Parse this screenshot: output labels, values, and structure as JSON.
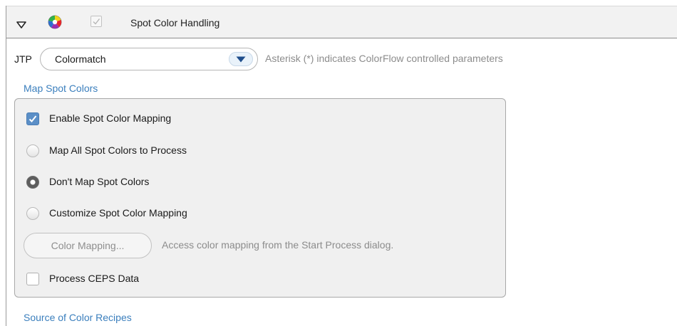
{
  "header": {
    "title": "Spot Color Handling",
    "checked": true,
    "icons": [
      "collapse-triangle-icon",
      "color-wheel-icon",
      "checkmark-icon"
    ]
  },
  "jtp": {
    "label": "JTP",
    "selected": "Colormatch",
    "note": "Asterisk (*) indicates ColorFlow controlled parameters"
  },
  "map_spot_colors": {
    "title": "Map Spot Colors",
    "enable_mapping": {
      "label": "Enable Spot Color Mapping",
      "checked": true
    },
    "options": [
      {
        "label": "Map All Spot Colors to Process",
        "selected": false
      },
      {
        "label": "Don't Map Spot Colors",
        "selected": true
      },
      {
        "label": "Customize Spot Color Mapping",
        "selected": false
      }
    ],
    "color_mapping_button": "Color Mapping...",
    "color_mapping_note": "Access color mapping from the Start Process dialog.",
    "process_ceps": {
      "label": "Process CEPS Data",
      "checked": false
    }
  },
  "source_of_color_recipes": {
    "title": "Source of Color Recipes"
  },
  "colors": {
    "accent_text": "#3b7fbd",
    "checkbox_blue": "#5b8fc7",
    "muted_text": "#8c8c8c",
    "group_background": "#f0f0f0"
  }
}
